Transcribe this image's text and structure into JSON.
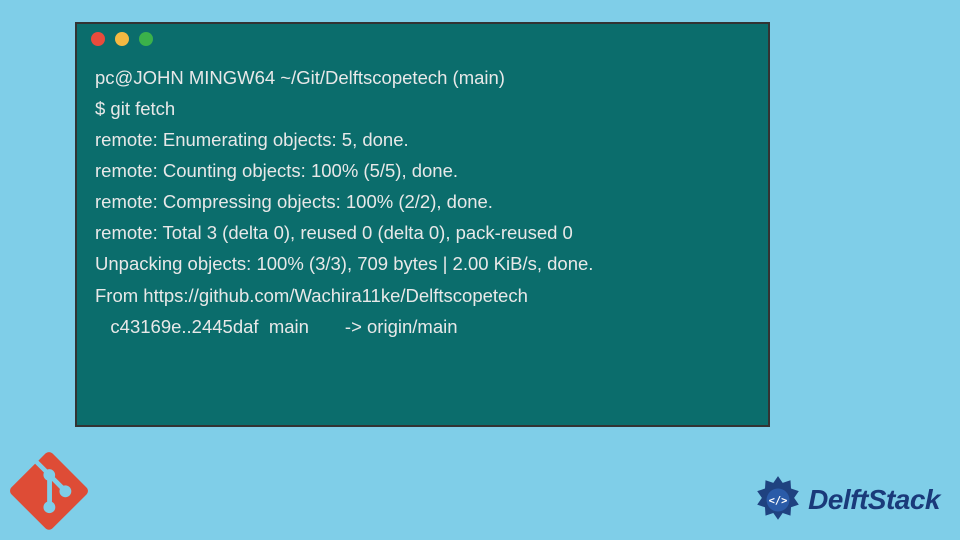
{
  "terminal": {
    "prompt": "pc@JOHN MINGW64 ~/Git/Delftscopetech (main)",
    "command": "$ git fetch",
    "lines": [
      "remote: Enumerating objects: 5, done.",
      "remote: Counting objects: 100% (5/5), done.",
      "remote: Compressing objects: 100% (2/2), done.",
      "remote: Total 3 (delta 0), reused 0 (delta 0), pack-reused 0",
      "Unpacking objects: 100% (3/3), 709 bytes | 2.00 KiB/s, done.",
      "From https://github.com/Wachira11ke/Delftscopetech",
      "   c43169e..2445daf  main       -> origin/main"
    ]
  },
  "brand": {
    "name": "DelftStack"
  }
}
